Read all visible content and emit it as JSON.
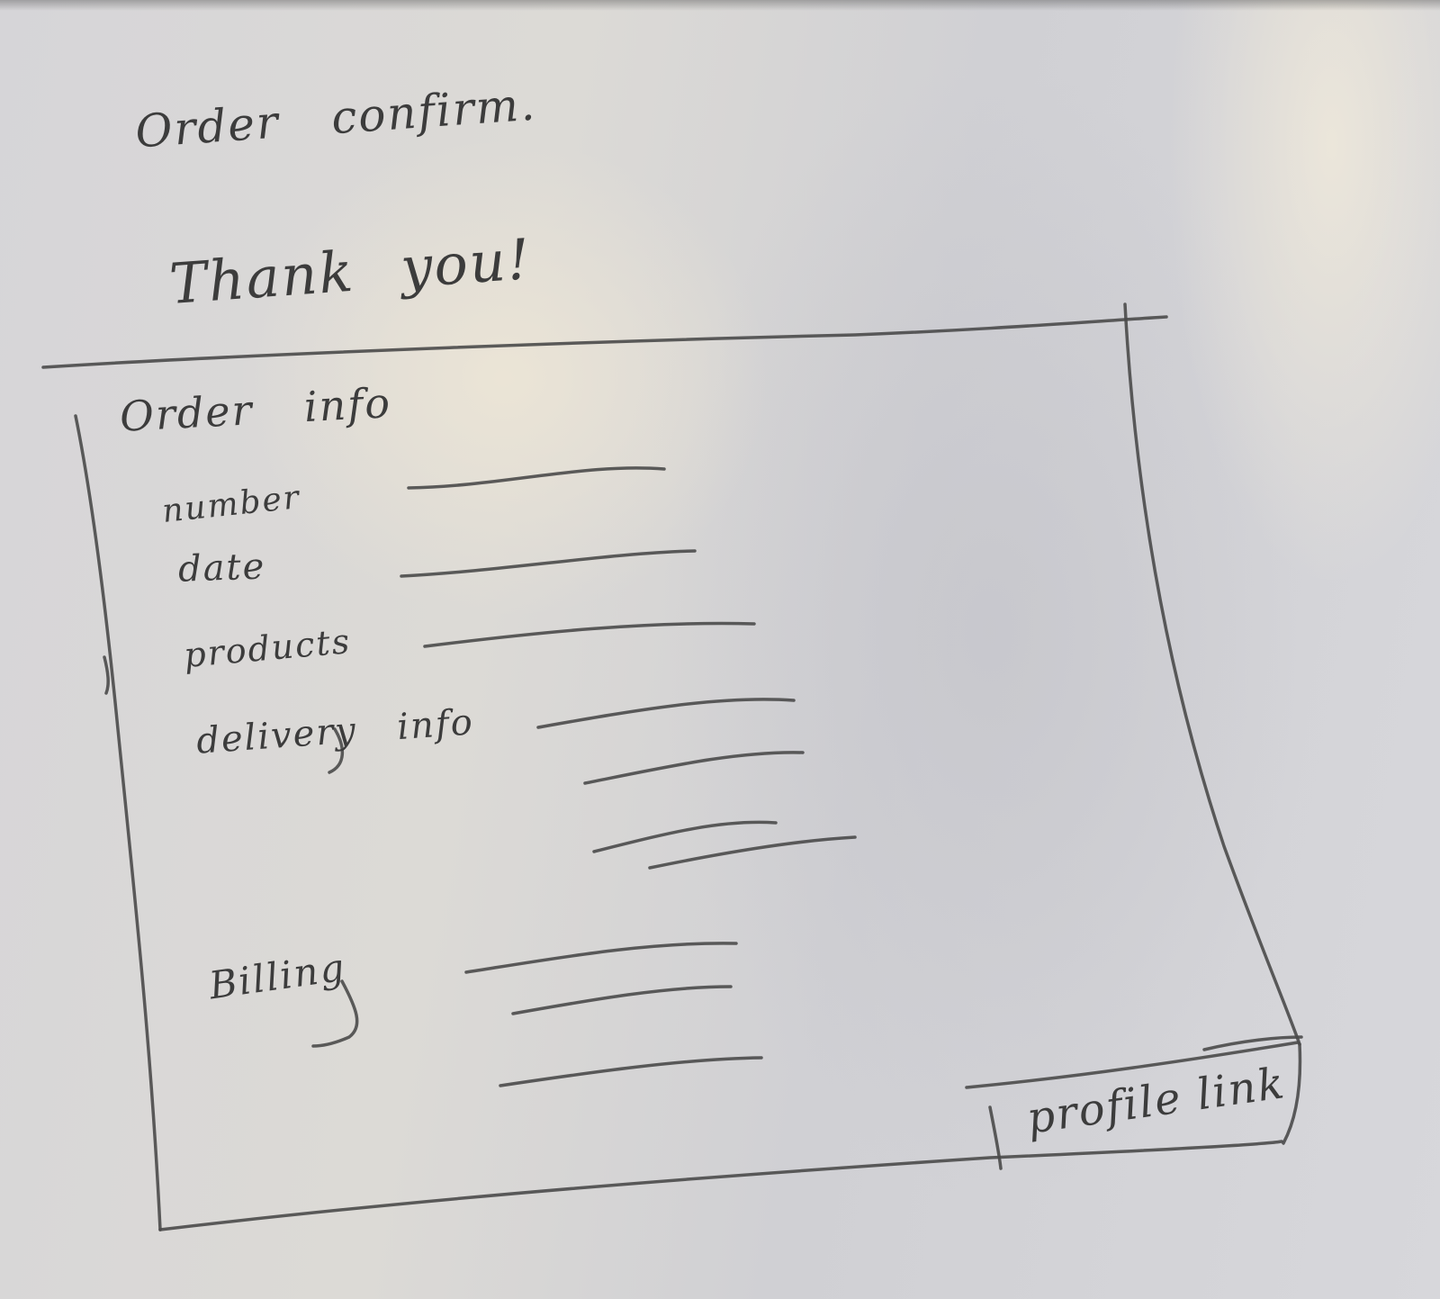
{
  "page": {
    "title": "Order confirm.",
    "greeting": "Thank you!"
  },
  "order_info": {
    "title": "Order info",
    "fields": {
      "number": "number",
      "date": "date",
      "products": "products",
      "delivery_info": "delivery info",
      "billing": "Billing"
    }
  },
  "footer": {
    "profile_link": "profile link"
  }
}
